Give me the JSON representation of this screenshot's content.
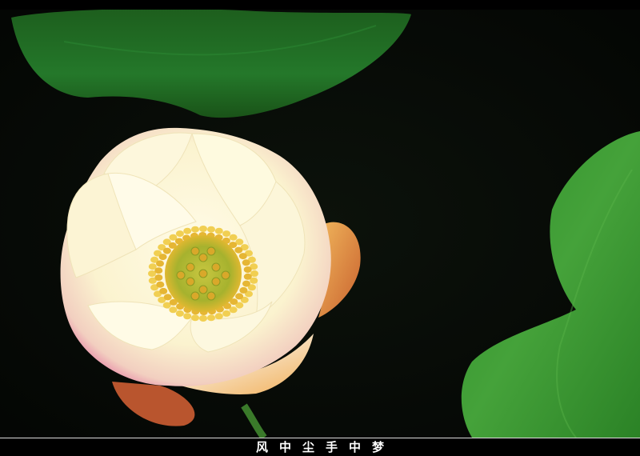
{
  "caption": "风中尘手中梦",
  "colors": {
    "background": "#000000",
    "leaf_dark": "#1f6a1c",
    "leaf_light": "#3f9a36",
    "petal": "#fbf5d6",
    "petal_tip": "#e889a8",
    "stamen": "#e8c23c",
    "receptacle": "#b7c23a",
    "caption_text": "#ffffff"
  },
  "scene": {
    "subject": "lotus-flower",
    "elements": [
      "top-leaf",
      "right-leaf",
      "lotus-bloom",
      "stem"
    ]
  }
}
